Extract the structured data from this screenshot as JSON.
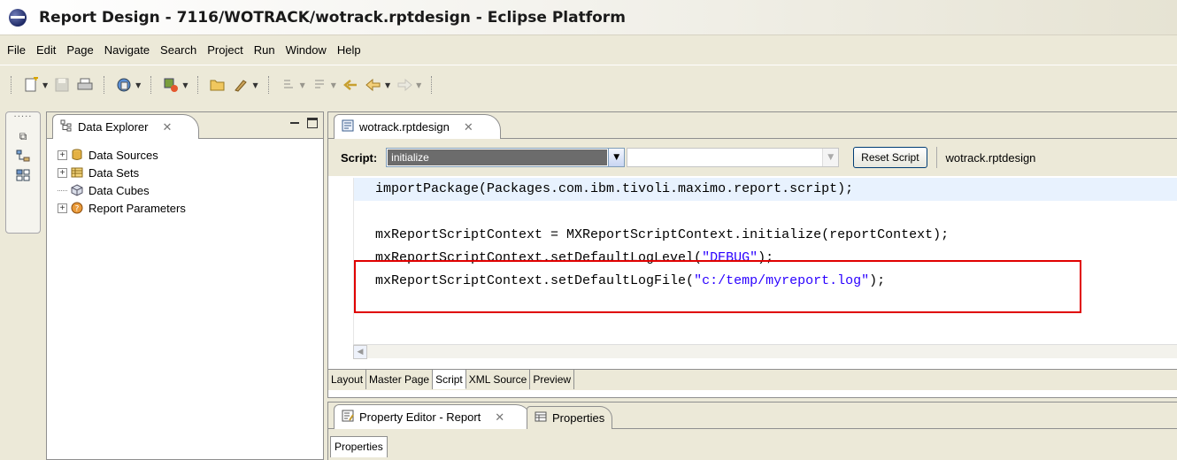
{
  "window": {
    "title": "Report Design - 7116/WOTRACK/wotrack.rptdesign - Eclipse Platform"
  },
  "menu": [
    "File",
    "Edit",
    "Page",
    "Navigate",
    "Search",
    "Project",
    "Run",
    "Window",
    "Help"
  ],
  "explorer": {
    "tab_label": "Data Explorer",
    "items": [
      {
        "label": "Data Sources",
        "icon": "database-icon",
        "expandable": true
      },
      {
        "label": "Data Sets",
        "icon": "dataset-icon",
        "expandable": true
      },
      {
        "label": "Data Cubes",
        "icon": "cube-icon",
        "expandable": false
      },
      {
        "label": "Report Parameters",
        "icon": "parameters-icon",
        "expandable": true
      }
    ]
  },
  "editor": {
    "tab_label": "wotrack.rptdesign",
    "script_label": "Script:",
    "selected_method": "initialize",
    "reset_label": "Reset Script",
    "file_label": "wotrack.rptdesign",
    "code": [
      {
        "pre": "importPackage(Packages.com.ibm.tivoli.maximo.report.script);",
        "str": "",
        "post": ""
      },
      {
        "pre": "",
        "str": "",
        "post": ""
      },
      {
        "pre": "mxReportScriptContext = MXReportScriptContext.initialize(reportContext);",
        "str": "",
        "post": ""
      },
      {
        "pre": "mxReportScriptContext.setDefaultLogLevel(",
        "str": "\"DEBUG\"",
        "post": ");"
      },
      {
        "pre": "mxReportScriptContext.setDefaultLogFile(",
        "str": "\"c:/temp/myreport.log\"",
        "post": ");"
      }
    ],
    "bottom_tabs": [
      "Layout",
      "Master Page",
      "Script",
      "XML Source",
      "Preview"
    ],
    "active_bottom_tab": "Script"
  },
  "property_editor": {
    "tab_label": "Property Editor - Report",
    "tab2_label": "Properties",
    "subtab_label": "Properties"
  },
  "colors": {
    "highlight_box": "#e00000",
    "string_literal": "#2a00ff"
  }
}
